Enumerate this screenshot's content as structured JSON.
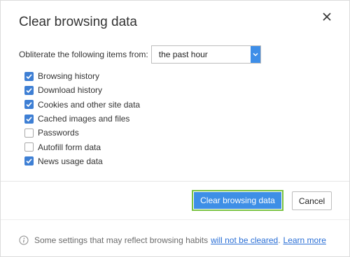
{
  "dialog": {
    "title": "Clear browsing data",
    "close_icon": "close-icon"
  },
  "period": {
    "label": "Obliterate the following items from:",
    "selected": "the past hour"
  },
  "options": [
    {
      "label": "Browsing history",
      "checked": true
    },
    {
      "label": "Download history",
      "checked": true
    },
    {
      "label": "Cookies and other site data",
      "checked": true
    },
    {
      "label": "Cached images and files",
      "checked": true
    },
    {
      "label": "Passwords",
      "checked": false
    },
    {
      "label": "Autofill form data",
      "checked": false
    },
    {
      "label": "News usage data",
      "checked": true
    }
  ],
  "buttons": {
    "clear_label": "Clear browsing data",
    "cancel_label": "Cancel"
  },
  "footer": {
    "info_icon": "info-icon",
    "text": "Some settings that may reflect browsing habits",
    "link_not_cleared": "will not be cleared",
    "period_dot": ".",
    "link_learn_more": "Learn more"
  },
  "colors": {
    "accent": "#3e8fe6",
    "focus_ring": "#79c241",
    "checkbox": "#3e7fd4",
    "link": "#2a6fd6"
  }
}
